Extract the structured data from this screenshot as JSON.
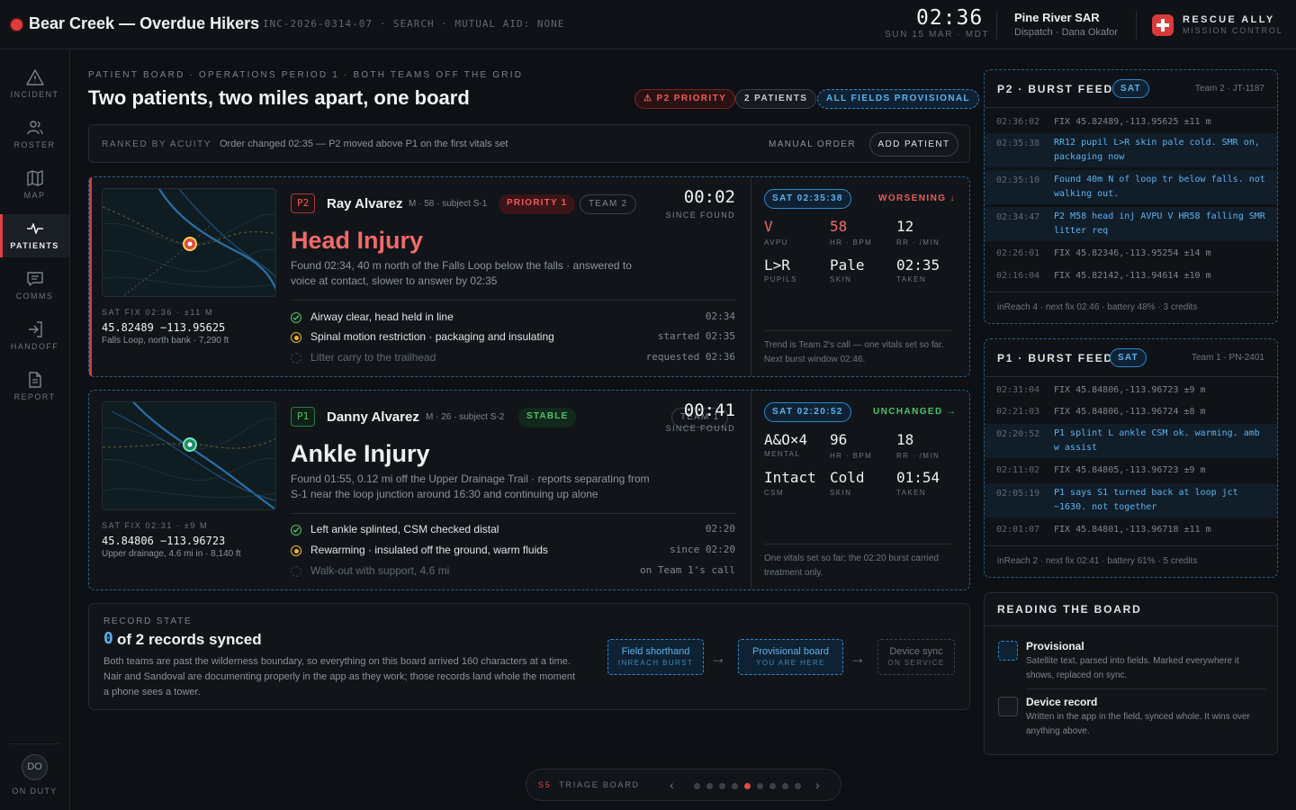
{
  "header": {
    "title": "Bear Creek — Overdue Hikers",
    "incident_meta": "INC-2026-0314-07 · SEARCH · MUTUAL AID: NONE",
    "clock": "02:36",
    "date": "SUN 15 MAR · MDT",
    "team_name": "Pine River SAR",
    "team_sub": "Dispatch · Dana Okafor",
    "brand_title": "RESCUE ALLY",
    "brand_sub": "MISSION CONTROL"
  },
  "sidebar": {
    "items": [
      {
        "label": "INCIDENT",
        "icon": "warning-icon"
      },
      {
        "label": "ROSTER",
        "icon": "people-icon"
      },
      {
        "label": "MAP",
        "icon": "map-icon"
      },
      {
        "label": "PATIENTS",
        "icon": "pulse-icon",
        "active": true
      },
      {
        "label": "COMMS",
        "icon": "chat-icon"
      },
      {
        "label": "HANDOFF",
        "icon": "handoff-icon"
      },
      {
        "label": "REPORT",
        "icon": "document-icon"
      }
    ],
    "avatar": "DO",
    "status": "ON DUTY"
  },
  "board": {
    "kicker": "PATIENT BOARD · OPERATIONS PERIOD 1 · BOTH TEAMS OFF THE GRID",
    "title": "Two patients, two miles apart, one board",
    "chip_priority": "P2 PRIORITY",
    "chip_patients": "2 PATIENTS",
    "chip_provisional": "ALL FIELDS PROVISIONAL",
    "rank_label": "RANKED BY ACUITY",
    "rank_note": "Order changed 02:35 — P2 moved above P1 on the first vitals set",
    "manual_order": "MANUAL ORDER",
    "add_patient": "ADD PATIENT"
  },
  "patients": [
    {
      "tag": "P2",
      "name": "Ray Alvarez",
      "meta": "M · 58 · subject S-1",
      "status": "PRIORITY 1",
      "team": "TEAM 2",
      "timer": "00:02",
      "since": "SINCE FOUND",
      "diagnosis": "Head Injury",
      "found": "Found 02:34, 40 m north of the Falls Loop below the falls · answered to voice at contact, slower to answer by 02:35",
      "fix_label": "SAT FIX 02:36 · ±11 M",
      "coords": "45.82489 −113.95625",
      "place": "Falls Loop, north bank · 7,290 ft",
      "steps": [
        {
          "text": "Airway clear, head held in line",
          "time": "02:34",
          "state": "done"
        },
        {
          "text": "Spinal motion restriction · packaging and insulating",
          "time": "started 02:35",
          "state": "active"
        },
        {
          "text": "Litter carry to the trailhead",
          "time": "requested 02:36",
          "state": "pending"
        }
      ],
      "vitals_sat": "SAT 02:35:38",
      "trend": "WORSENING ↓",
      "vitals": [
        {
          "value": "V",
          "label": "AVPU"
        },
        {
          "value": "58",
          "label": "HR · BPM"
        },
        {
          "value": "12",
          "label": "RR · /MIN"
        },
        {
          "value": "L>R",
          "label": "PUPILS"
        },
        {
          "value": "Pale",
          "label": "SKIN"
        },
        {
          "value": "02:35",
          "label": "TAKEN"
        }
      ],
      "vitals_note": "Trend is Team 2's call — one vitals set so far. Next burst window 02:46."
    },
    {
      "tag": "P1",
      "name": "Danny Alvarez",
      "meta": "M · 26 · subject S-2",
      "status": "STABLE",
      "team": "TEAM 1",
      "timer": "00:41",
      "since": "SINCE FOUND",
      "diagnosis": "Ankle Injury",
      "found": "Found 01:55, 0.12 mi off the Upper Drainage Trail · reports separating from S-1 near the loop junction around 16:30 and continuing up alone",
      "fix_label": "SAT FIX 02:31 · ±9 M",
      "coords": "45.84806 −113.96723",
      "place": "Upper drainage, 4.6 mi in · 8,140 ft",
      "steps": [
        {
          "text": "Left ankle splinted, CSM checked distal",
          "time": "02:20",
          "state": "done"
        },
        {
          "text": "Rewarming · insulated off the ground, warm fluids",
          "time": "since 02:20",
          "state": "active"
        },
        {
          "text": "Walk-out with support, 4.6 mi",
          "time": "on Team 1's call",
          "state": "pending"
        }
      ],
      "vitals_sat": "SAT 02:20:52",
      "trend": "UNCHANGED →",
      "vitals": [
        {
          "value": "A&O×4",
          "label": "MENTAL"
        },
        {
          "value": "96",
          "label": "HR · BPM"
        },
        {
          "value": "18",
          "label": "RR · /MIN"
        },
        {
          "value": "Intact",
          "label": "CSM"
        },
        {
          "value": "Cold",
          "label": "SKIN"
        },
        {
          "value": "01:54",
          "label": "TAKEN"
        }
      ],
      "vitals_note": "One vitals set so far; the 02:20 burst carried treatment only."
    }
  ],
  "record": {
    "label": "RECORD STATE",
    "count": "0",
    "title_rest": "of 2 records synced",
    "body": "Both teams are past the wilderness boundary, so everything on this board arrived 160 characters at a time. Nair and Sandoval are documenting properly in the app as they work; those records land whole the moment a phone sees a tower.",
    "flow": [
      {
        "a": "Field shorthand",
        "b": "INREACH BURST"
      },
      {
        "a": "Provisional board",
        "b": "YOU ARE HERE"
      },
      {
        "a": "Device sync",
        "b": "ON SERVICE"
      }
    ]
  },
  "feeds": [
    {
      "title": "P2 · BURST FEED",
      "sat": "SAT",
      "team": "Team 2 · JT-1187",
      "rows": [
        {
          "t": "02:36:02",
          "m": "FIX 45.82489,-113.95625 ±11 m",
          "msg": false
        },
        {
          "t": "02:35:38",
          "m": "RR12 pupil L>R skin pale cold. SMR on, packaging now",
          "msg": true
        },
        {
          "t": "02:35:10",
          "m": "Found 40m N of loop tr below falls. not walking out.",
          "msg": true
        },
        {
          "t": "02:34:47",
          "m": "P2 M58 head inj AVPU V HR58 falling SMR litter req",
          "msg": true
        },
        {
          "t": "02:26:01",
          "m": "FIX 45.82346,-113.95254 ±14 m",
          "msg": false
        },
        {
          "t": "02:16:04",
          "m": "FIX 45.82142,-113.94614 ±10 m",
          "msg": false
        }
      ],
      "footer": "inReach 4 · next fix 02:46 · battery 48% · 3 credits"
    },
    {
      "title": "P1 · BURST FEED",
      "sat": "SAT",
      "team": "Team 1 · PN-2401",
      "rows": [
        {
          "t": "02:31:04",
          "m": "FIX 45.84806,-113.96723 ±9 m",
          "msg": false
        },
        {
          "t": "02:21:03",
          "m": "FIX 45.84806,-113.96724 ±8 m",
          "msg": false
        },
        {
          "t": "02:20:52",
          "m": "P1 splint L ankle CSM ok. warming. amb w assist",
          "msg": true
        },
        {
          "t": "02:11:02",
          "m": "FIX 45.84805,-113.96723 ±9 m",
          "msg": false
        },
        {
          "t": "02:05:19",
          "m": "P1 says S1 turned back at loop jct ~1630. not together",
          "msg": true
        },
        {
          "t": "02:01:07",
          "m": "FIX 45.84801,-113.96718 ±11 m",
          "msg": false
        }
      ],
      "footer": "inReach 2 · next fix 02:41 · battery 61% · 5 credits"
    }
  ],
  "reading": {
    "title": "READING THE BOARD",
    "items": [
      {
        "h": "Provisional",
        "d": "Satellite text, parsed into fields. Marked everywhere it shows, replaced on sync."
      },
      {
        "h": "Device record",
        "d": "Written in the app in the field, synced whole. It wins over anything above."
      }
    ]
  },
  "pager": {
    "slide": "S5",
    "label": "TRIAGE BOARD",
    "current": 5,
    "total": 9
  },
  "colors": {
    "accent_red": "#e04848",
    "accent_green": "#4cc26a",
    "accent_blue": "#5ab3ee",
    "accent_amber": "#f0b429"
  }
}
